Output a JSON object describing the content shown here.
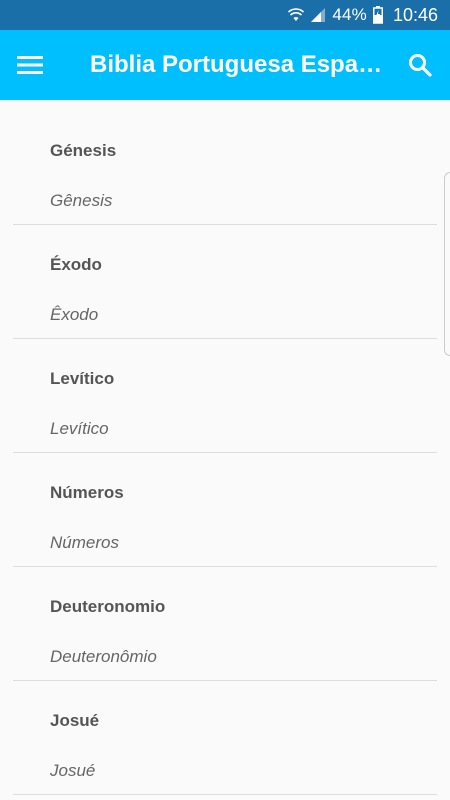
{
  "status_bar": {
    "battery": "44%",
    "time": "10:46"
  },
  "app_bar": {
    "title": "Biblia Portuguesa Español",
    "menu_icon": "hamburger-menu-icon",
    "search_icon": "search-icon",
    "color": "#00bfff"
  },
  "books": [
    {
      "spanish": "Génesis",
      "portuguese": "Gênesis"
    },
    {
      "spanish": "Éxodo",
      "portuguese": "Êxodo"
    },
    {
      "spanish": "Levítico",
      "portuguese": "Levítico"
    },
    {
      "spanish": "Números",
      "portuguese": "Números"
    },
    {
      "spanish": "Deuteronomio",
      "portuguese": "Deuteronômio"
    },
    {
      "spanish": "Josué",
      "portuguese": "Josué"
    }
  ]
}
